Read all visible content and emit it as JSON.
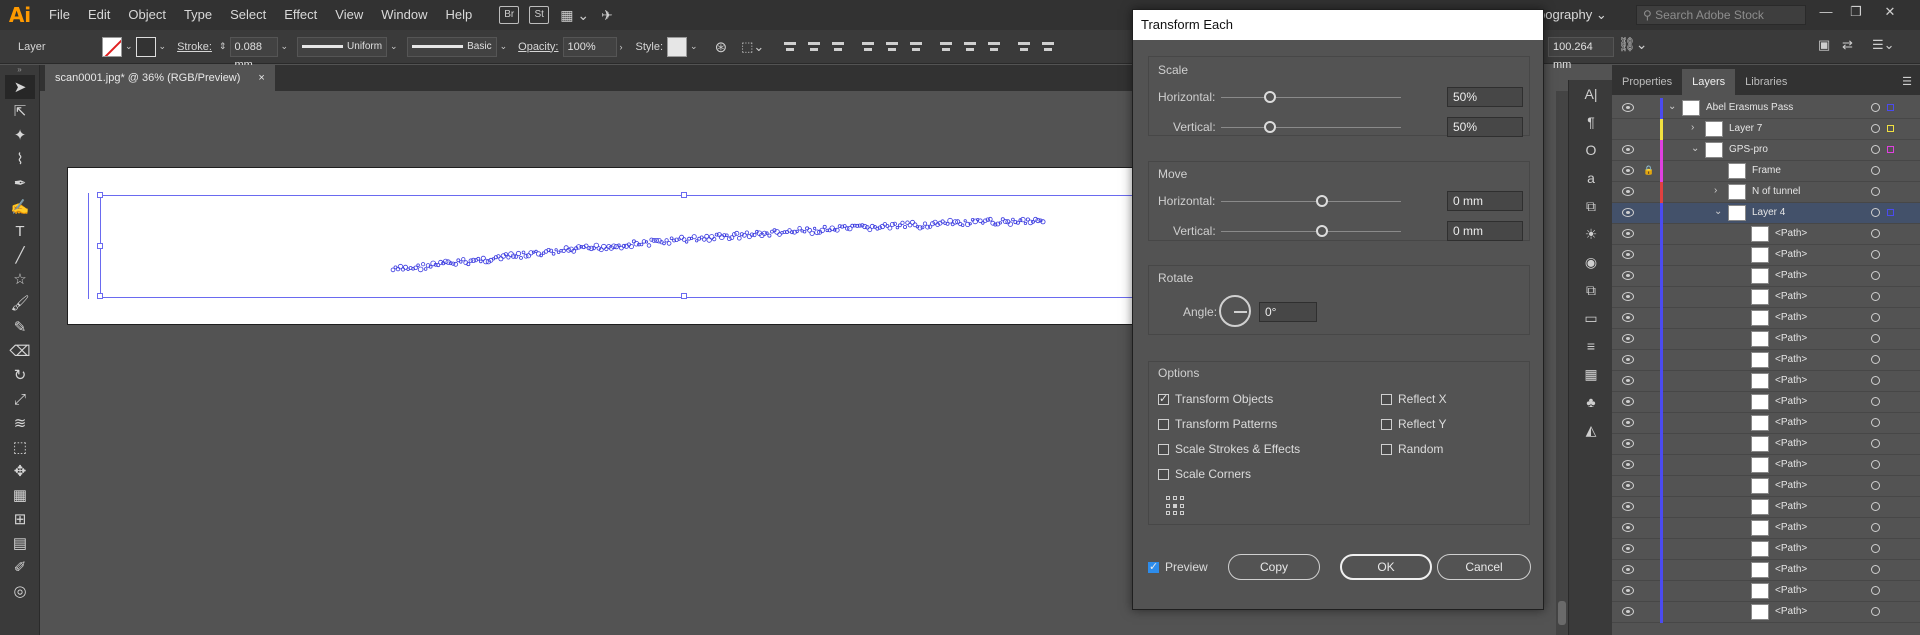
{
  "app": {
    "logo": "Ai",
    "workspace": "pography",
    "search_placeholder": "Search Adobe Stock"
  },
  "menu": [
    "File",
    "Edit",
    "Object",
    "Type",
    "Select",
    "Effect",
    "View",
    "Window",
    "Help"
  ],
  "menu_badges": [
    "Br",
    "St"
  ],
  "control_bar": {
    "selection_label": "Layer",
    "stroke_label": "Stroke:",
    "stroke_weight": "0.088 mm",
    "stroke_profile": "Uniform",
    "brush": "Basic",
    "opacity_label": "Opacity:",
    "opacity_value": "100%",
    "style_label": "Style:",
    "width_value": "100.264 mm"
  },
  "document_tab": {
    "title": "scan0001.jpg* @ 36% (RGB/Preview)",
    "close": "×"
  },
  "tools": [
    "selection-tool",
    "direct-selection-tool",
    "magic-wand-tool",
    "lasso-tool",
    "pen-tool",
    "curvature-tool",
    "type-tool",
    "line-tool",
    "star-tool",
    "paintbrush-tool",
    "shaper-tool",
    "eraser-tool",
    "rotate-tool",
    "scale-tool",
    "warp-tool",
    "free-transform-tool",
    "puppet-warp-tool",
    "perspective-grid-tool",
    "mesh-tool",
    "gradient-tool",
    "eyedropper-tool",
    "blend-tool"
  ],
  "layers_panel": {
    "tabs": [
      "Properties",
      "Layers",
      "Libraries"
    ],
    "active_tab": "Layers",
    "rows": [
      {
        "name": "Abel Erasmus Pass",
        "indent": 0,
        "arrow": "⌄",
        "color": "#4b4bf0",
        "eye": true,
        "lock": false,
        "selected": false
      },
      {
        "name": "Layer 7",
        "indent": 1,
        "arrow": "›",
        "color": "#f0e040",
        "eye": false,
        "lock": false,
        "selected": false
      },
      {
        "name": "GPS-pro",
        "indent": 1,
        "arrow": "⌄",
        "color": "#e040e0",
        "eye": true,
        "lock": false,
        "selected": false
      },
      {
        "name": "Frame",
        "indent": 2,
        "arrow": "",
        "color": "#e040e0",
        "eye": true,
        "lock": true,
        "selected": false
      },
      {
        "name": "N of tunnel",
        "indent": 2,
        "arrow": "›",
        "color": "#e04040",
        "eye": true,
        "lock": false,
        "selected": false
      },
      {
        "name": "Layer 4",
        "indent": 2,
        "arrow": "⌄",
        "color": "#4b4bf0",
        "eye": true,
        "lock": false,
        "selected": true
      },
      {
        "name": "<Path>",
        "indent": 3,
        "arrow": "",
        "color": "#4b4bf0",
        "eye": true,
        "lock": false,
        "selected": false
      },
      {
        "name": "<Path>",
        "indent": 3,
        "arrow": "",
        "color": "#4b4bf0",
        "eye": true,
        "lock": false,
        "selected": false
      },
      {
        "name": "<Path>",
        "indent": 3,
        "arrow": "",
        "color": "#4b4bf0",
        "eye": true,
        "lock": false,
        "selected": false
      },
      {
        "name": "<Path>",
        "indent": 3,
        "arrow": "",
        "color": "#4b4bf0",
        "eye": true,
        "lock": false,
        "selected": false
      },
      {
        "name": "<Path>",
        "indent": 3,
        "arrow": "",
        "color": "#4b4bf0",
        "eye": true,
        "lock": false,
        "selected": false
      },
      {
        "name": "<Path>",
        "indent": 3,
        "arrow": "",
        "color": "#4b4bf0",
        "eye": true,
        "lock": false,
        "selected": false
      },
      {
        "name": "<Path>",
        "indent": 3,
        "arrow": "",
        "color": "#4b4bf0",
        "eye": true,
        "lock": false,
        "selected": false
      },
      {
        "name": "<Path>",
        "indent": 3,
        "arrow": "",
        "color": "#4b4bf0",
        "eye": true,
        "lock": false,
        "selected": false
      },
      {
        "name": "<Path>",
        "indent": 3,
        "arrow": "",
        "color": "#4b4bf0",
        "eye": true,
        "lock": false,
        "selected": false
      },
      {
        "name": "<Path>",
        "indent": 3,
        "arrow": "",
        "color": "#4b4bf0",
        "eye": true,
        "lock": false,
        "selected": false
      },
      {
        "name": "<Path>",
        "indent": 3,
        "arrow": "",
        "color": "#4b4bf0",
        "eye": true,
        "lock": false,
        "selected": false
      },
      {
        "name": "<Path>",
        "indent": 3,
        "arrow": "",
        "color": "#4b4bf0",
        "eye": true,
        "lock": false,
        "selected": false
      },
      {
        "name": "<Path>",
        "indent": 3,
        "arrow": "",
        "color": "#4b4bf0",
        "eye": true,
        "lock": false,
        "selected": false
      },
      {
        "name": "<Path>",
        "indent": 3,
        "arrow": "",
        "color": "#4b4bf0",
        "eye": true,
        "lock": false,
        "selected": false
      },
      {
        "name": "<Path>",
        "indent": 3,
        "arrow": "",
        "color": "#4b4bf0",
        "eye": true,
        "lock": false,
        "selected": false
      },
      {
        "name": "<Path>",
        "indent": 3,
        "arrow": "",
        "color": "#4b4bf0",
        "eye": true,
        "lock": false,
        "selected": false
      },
      {
        "name": "<Path>",
        "indent": 3,
        "arrow": "",
        "color": "#4b4bf0",
        "eye": true,
        "lock": false,
        "selected": false
      },
      {
        "name": "<Path>",
        "indent": 3,
        "arrow": "",
        "color": "#4b4bf0",
        "eye": true,
        "lock": false,
        "selected": false
      },
      {
        "name": "<Path>",
        "indent": 3,
        "arrow": "",
        "color": "#4b4bf0",
        "eye": true,
        "lock": false,
        "selected": false
      }
    ]
  },
  "dialog": {
    "title": "Transform Each",
    "scale": {
      "title": "Scale",
      "horizontal_label": "Horizontal:",
      "horizontal_value": "50%",
      "vertical_label": "Vertical:",
      "vertical_value": "50%"
    },
    "move": {
      "title": "Move",
      "horizontal_label": "Horizontal:",
      "horizontal_value": "0 mm",
      "vertical_label": "Vertical:",
      "vertical_value": "0 mm"
    },
    "rotate": {
      "title": "Rotate",
      "angle_label": "Angle:",
      "angle_value": "0°"
    },
    "options": {
      "title": "Options",
      "transform_objects": {
        "label": "Transform Objects",
        "checked": true
      },
      "transform_patterns": {
        "label": "Transform Patterns",
        "checked": false
      },
      "scale_strokes": {
        "label": "Scale Strokes & Effects",
        "checked": false
      },
      "scale_corners": {
        "label": "Scale Corners",
        "checked": false
      },
      "reflect_x": {
        "label": "Reflect X",
        "checked": false
      },
      "reflect_y": {
        "label": "Reflect Y",
        "checked": false
      },
      "random": {
        "label": "Random",
        "checked": false
      }
    },
    "preview": {
      "label": "Preview",
      "checked": true
    },
    "buttons": {
      "copy": "Copy",
      "ok": "OK",
      "cancel": "Cancel"
    }
  },
  "colors": {
    "selection": "#6a6af0",
    "path_dots": "#3a3ae0",
    "accent": "#2d8ceb"
  }
}
